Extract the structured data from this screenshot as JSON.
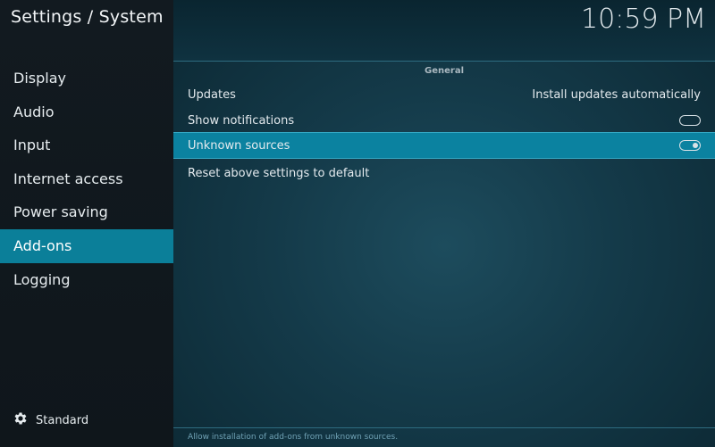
{
  "header": {
    "breadcrumb": "Settings / System",
    "clock": "10:59 PM"
  },
  "sidebar": {
    "items": [
      {
        "label": "Display"
      },
      {
        "label": "Audio"
      },
      {
        "label": "Input"
      },
      {
        "label": "Internet access"
      },
      {
        "label": "Power saving"
      },
      {
        "label": "Add-ons",
        "active": true
      },
      {
        "label": "Logging"
      }
    ],
    "settings_level": {
      "label": "Standard",
      "icon": "gear-icon"
    }
  },
  "main": {
    "section_title": "General",
    "settings": [
      {
        "label": "Updates",
        "value": "Install updates automatically"
      },
      {
        "label": "Show notifications",
        "toggle": "off"
      },
      {
        "label": "Unknown sources",
        "toggle": "on",
        "focused": true
      },
      {
        "label": "Reset above settings to default"
      }
    ],
    "hint": "Allow installation of add-ons from unknown sources."
  },
  "colors": {
    "accent": "#0b82a0",
    "sidebar_bg": "#121a20",
    "main_bg": "#143a49"
  }
}
